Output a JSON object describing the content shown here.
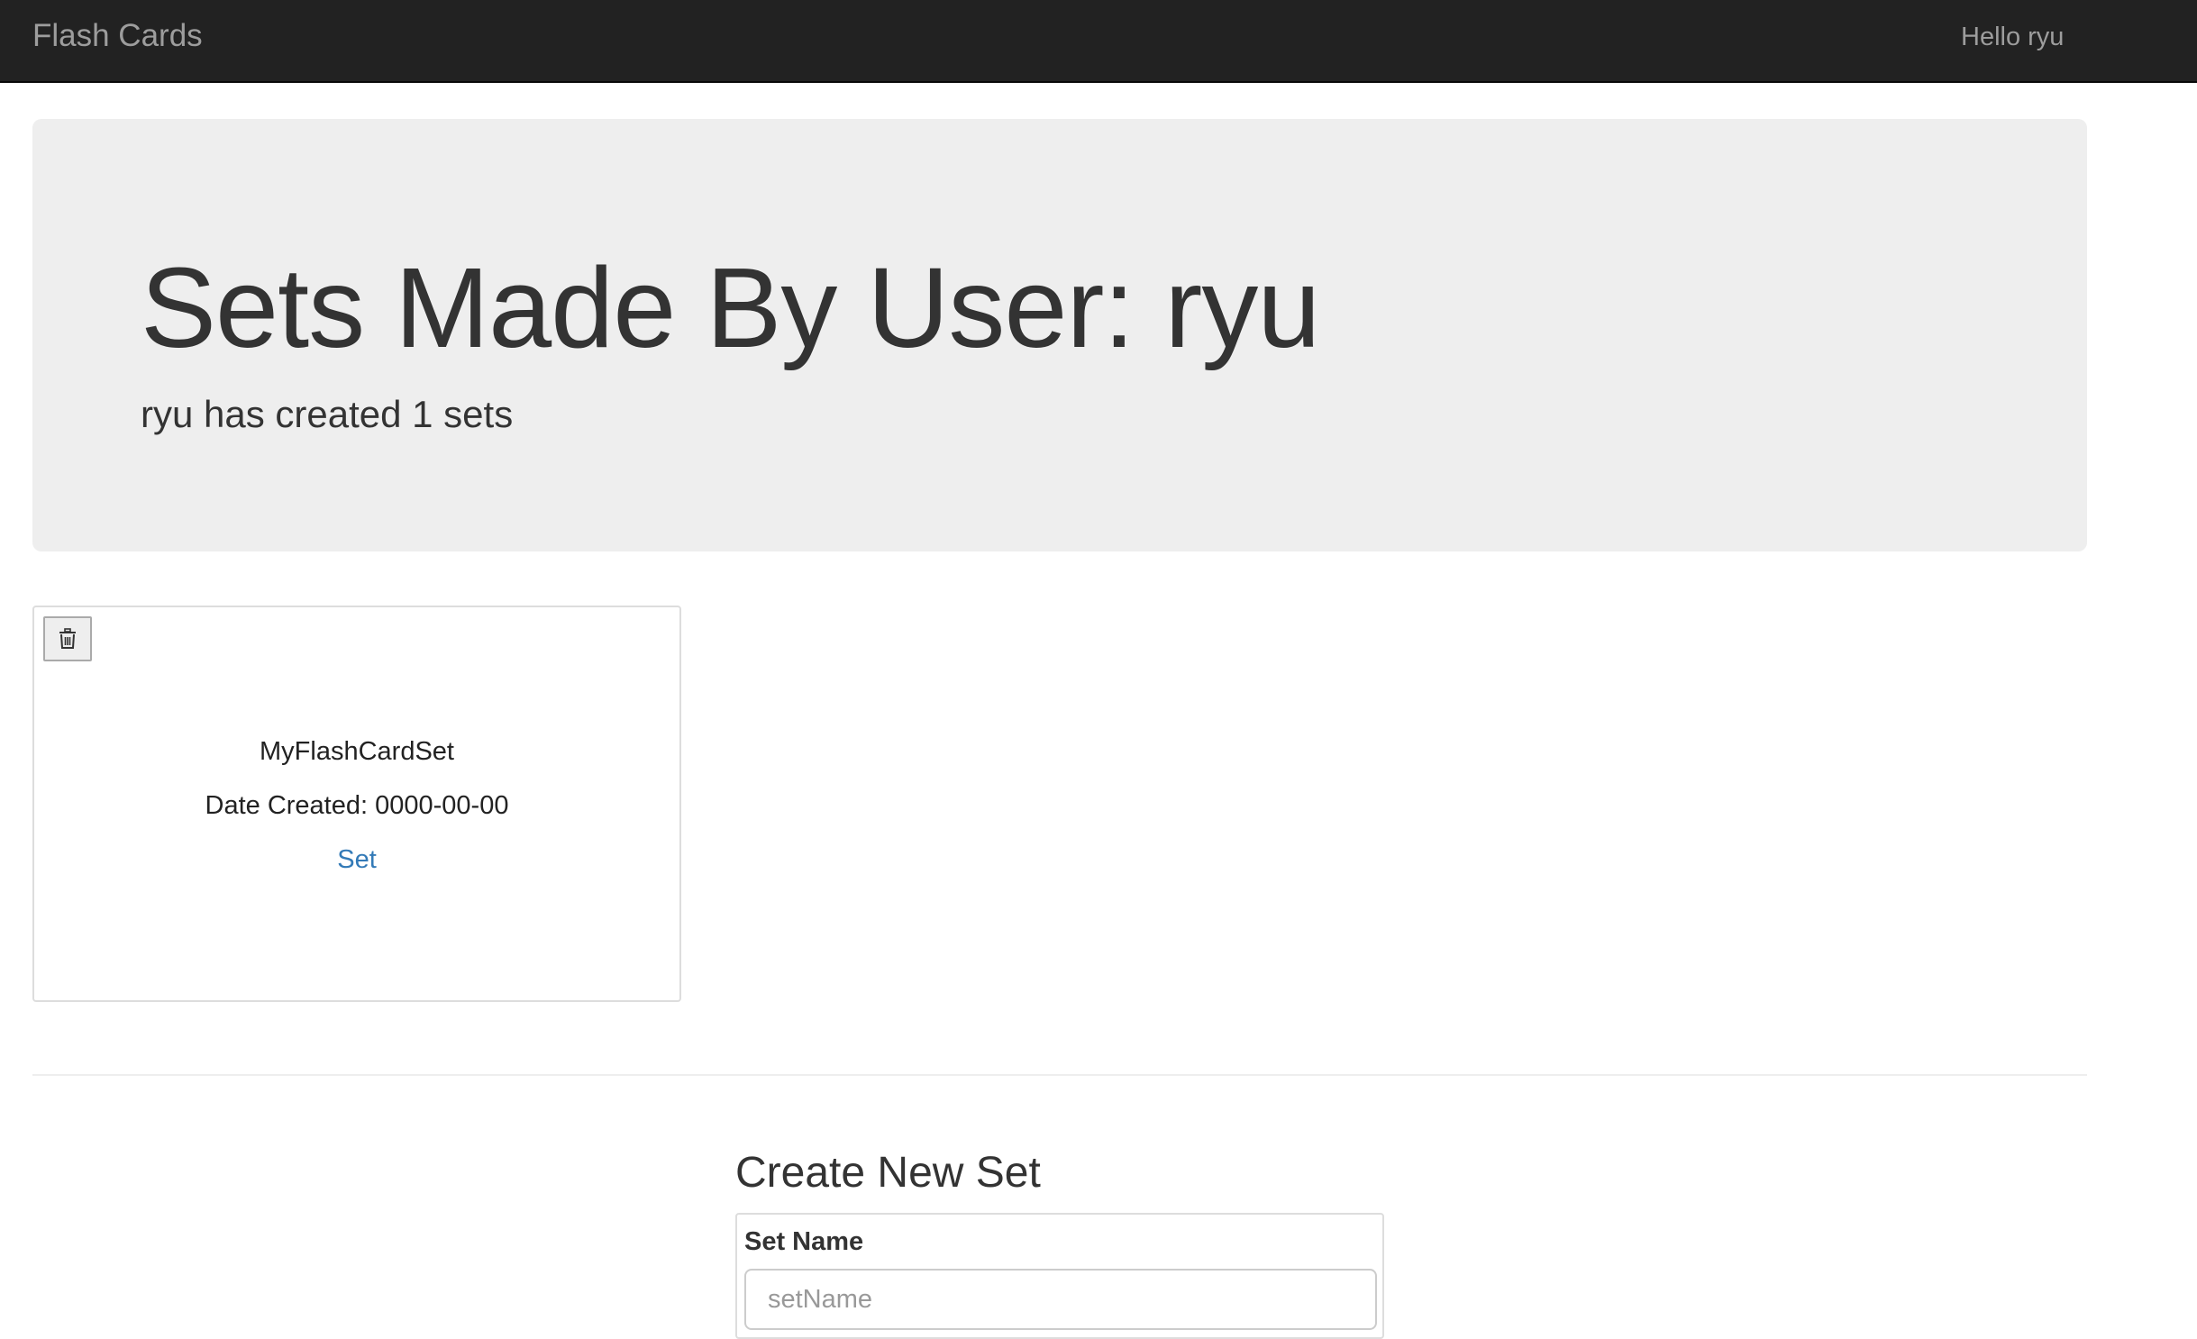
{
  "navbar": {
    "brand": "Flash Cards",
    "greeting": "Hello ryu"
  },
  "jumbotron": {
    "title": "Sets Made By User: ryu",
    "subtitle": "ryu has created 1 sets"
  },
  "sets": [
    {
      "name": "MyFlashCardSet",
      "date_created": "Date Created: 0000-00-00",
      "link_label": "Set",
      "delete_icon": "trash-icon"
    }
  ],
  "create_form": {
    "title": "Create New Set",
    "set_name_label": "Set Name",
    "set_name_placeholder": "setName"
  },
  "colors": {
    "navbar_bg": "#222222",
    "navbar_text": "#9d9d9d",
    "jumbotron_bg": "#eeeeee",
    "link": "#337ab7"
  }
}
